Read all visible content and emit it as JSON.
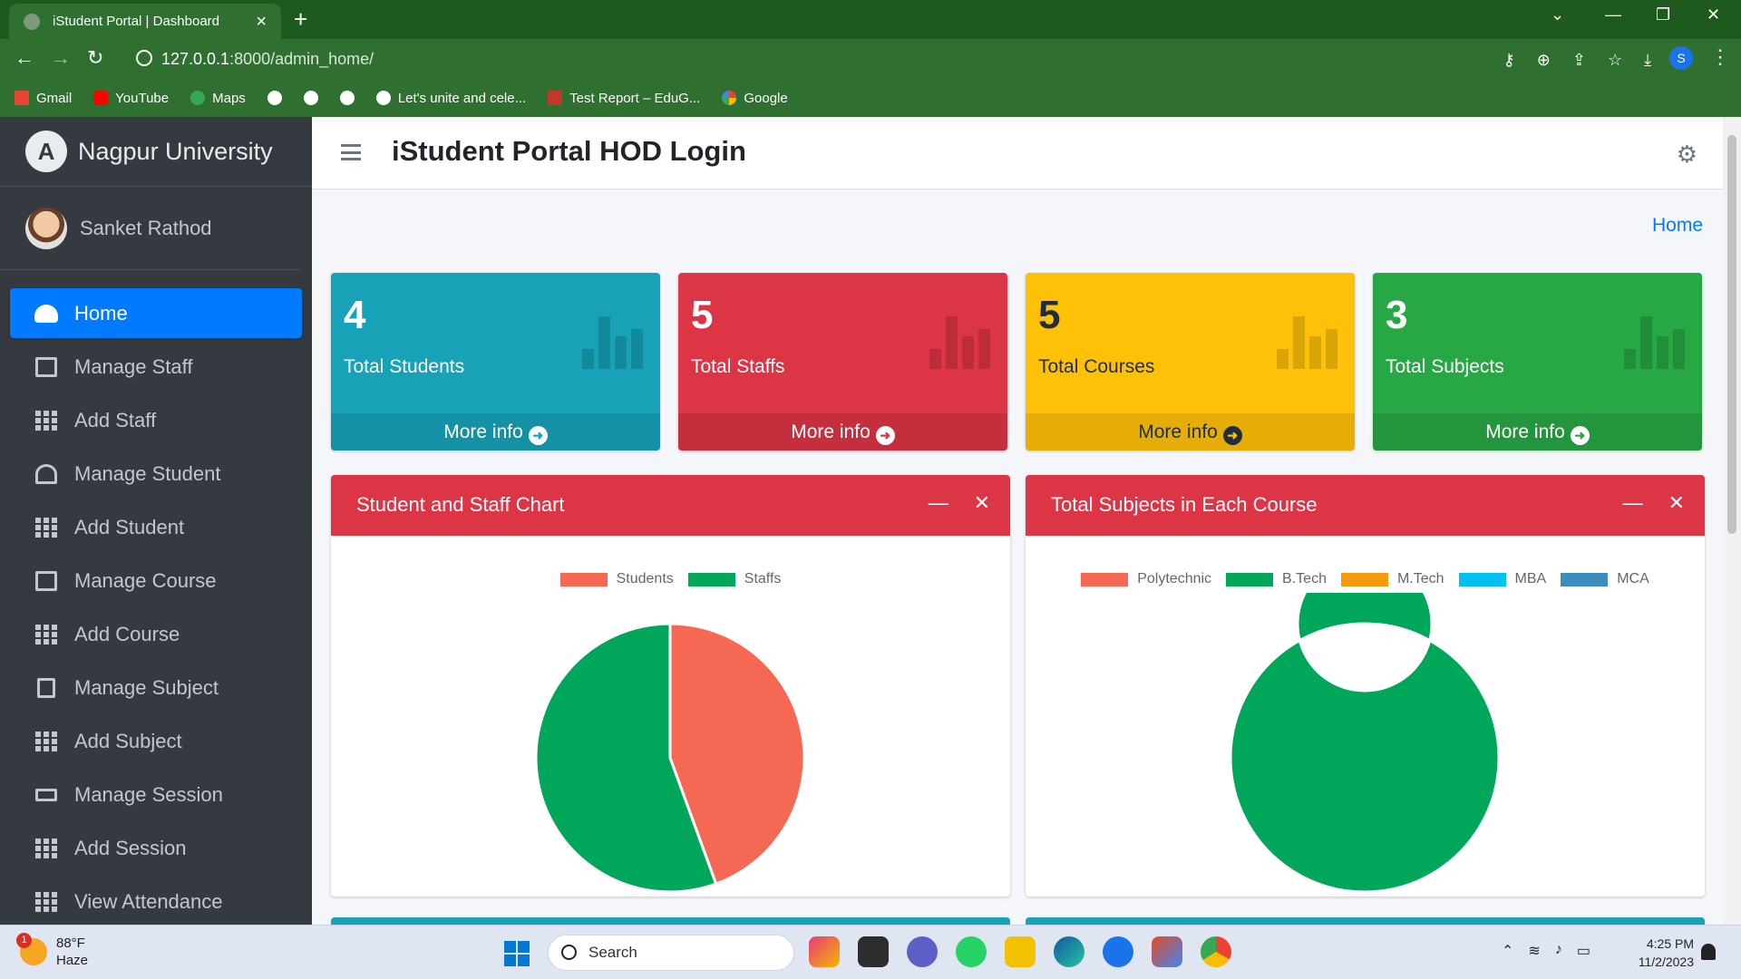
{
  "browser": {
    "tab_title": "iStudent Portal | Dashboard",
    "url_host": "127.0.0.1",
    "url_path": ":8000/admin_home/",
    "profile_initial": "S",
    "bookmarks": [
      "Gmail",
      "YouTube",
      "Maps",
      "Let's unite and cele...",
      "Test Report – EduG...",
      "Google"
    ]
  },
  "sidebar": {
    "brand": "Nagpur University",
    "user": "Sanket Rathod",
    "items": [
      {
        "label": "Home",
        "icon": "dashboard-icon"
      },
      {
        "label": "Manage Staff",
        "icon": "staff-icon"
      },
      {
        "label": "Add Staff",
        "icon": "grid-icon"
      },
      {
        "label": "Manage Student",
        "icon": "student-icon"
      },
      {
        "label": "Add Student",
        "icon": "grid-icon"
      },
      {
        "label": "Manage Course",
        "icon": "laptop-icon"
      },
      {
        "label": "Add Course",
        "icon": "grid-icon"
      },
      {
        "label": "Manage Subject",
        "icon": "book-icon"
      },
      {
        "label": "Add Subject",
        "icon": "grid-icon"
      },
      {
        "label": "Manage Session",
        "icon": "cap-icon"
      },
      {
        "label": "Add Session",
        "icon": "grid-icon"
      },
      {
        "label": "View Attendance",
        "icon": "calendar-icon"
      }
    ]
  },
  "header": {
    "title": "iStudent Portal HOD Login",
    "breadcrumb": "Home"
  },
  "stats": [
    {
      "value": "4",
      "label": "Total Students",
      "more": "More info",
      "color": "#17a2b8"
    },
    {
      "value": "5",
      "label": "Total Staffs",
      "more": "More info",
      "color": "#dc3545"
    },
    {
      "value": "5",
      "label": "Total Courses",
      "more": "More info",
      "color": "#ffc107"
    },
    {
      "value": "3",
      "label": "Total Subjects",
      "more": "More info",
      "color": "#28a745"
    }
  ],
  "charts": {
    "staff_chart_title": "Student and Staff Chart",
    "subject_chart_title": "Total Subjects in Each Course"
  },
  "chart_data": [
    {
      "type": "pie",
      "title": "Student and Staff Chart",
      "categories": [
        "Students",
        "Staffs"
      ],
      "values": [
        4,
        5
      ],
      "colors": [
        "#f56954",
        "#00a65a"
      ],
      "legend": "top"
    },
    {
      "type": "pie",
      "title": "Total Subjects in Each Course",
      "donut": true,
      "categories": [
        "Polytechnic",
        "B.Tech",
        "M.Tech",
        "MBA",
        "MCA"
      ],
      "values": [
        0,
        3,
        0,
        0,
        0
      ],
      "colors": [
        "#f56954",
        "#00a65a",
        "#f39c12",
        "#00c0ef",
        "#3c8dbc"
      ],
      "legend": "top"
    }
  ],
  "taskbar": {
    "temp": "88°F",
    "condition": "Haze",
    "weather_badge": "1",
    "search": "Search",
    "time": "4:25 PM",
    "date": "11/2/2023"
  }
}
